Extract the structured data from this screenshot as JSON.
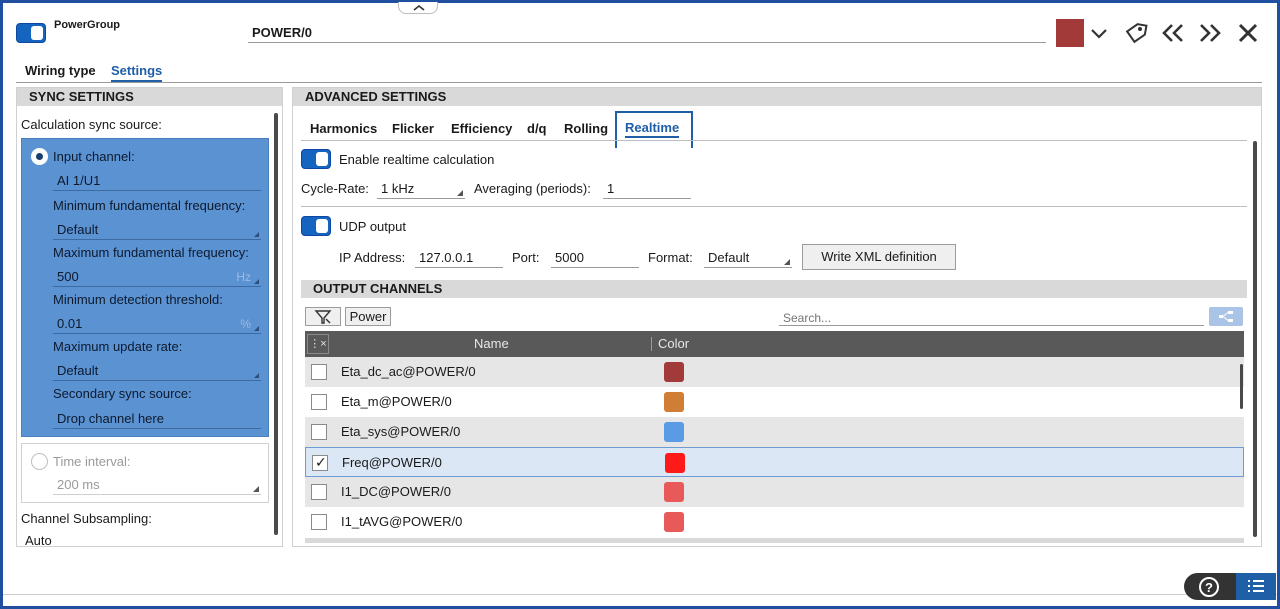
{
  "header": {
    "group_label": "PowerGroup",
    "name_value": "POWER/0",
    "color_swatch": "#a33a3a",
    "icons": [
      "chevron-down-icon",
      "tag-icon",
      "double-chevron-left-icon",
      "double-chevron-right-icon",
      "close-icon"
    ]
  },
  "top_tabs": [
    {
      "label": "Wiring type",
      "active": false
    },
    {
      "label": "Settings",
      "active": true
    }
  ],
  "sync": {
    "section_title": "SYNC SETTINGS",
    "calc_source_label": "Calculation sync source:",
    "input_channel_label": "Input channel:",
    "input_channel_value": "AI 1/U1",
    "min_freq_label": "Minimum fundamental frequency:",
    "min_freq_value": "Default",
    "max_freq_label": "Maximum fundamental frequency:",
    "max_freq_value": "500",
    "max_freq_unit": "Hz",
    "min_thresh_label": "Minimum detection threshold:",
    "min_thresh_value": "0.01",
    "min_thresh_unit": "%",
    "max_rate_label": "Maximum update rate:",
    "max_rate_value": "Default",
    "secondary_label": "Secondary sync source:",
    "secondary_value": "Drop channel here",
    "time_interval_label": "Time interval:",
    "time_interval_value": "200 ms",
    "subsampling_label": "Channel Subsampling:",
    "subsampling_value": "Auto"
  },
  "advanced": {
    "section_title": "ADVANCED SETTINGS",
    "tabs": [
      "Harmonics",
      "Flicker",
      "Efficiency",
      "d/q",
      "Rolling",
      "Realtime"
    ],
    "active_tab": "Realtime",
    "enable_label": "Enable realtime calculation",
    "cycle_rate_label": "Cycle-Rate:",
    "cycle_rate_value": "1 kHz",
    "averaging_label": "Averaging (periods):",
    "averaging_value": "1",
    "udp_label": "UDP output",
    "ip_label": "IP Address:",
    "ip_value": "127.0.0.1",
    "port_label": "Port:",
    "port_value": "5000",
    "format_label": "Format:",
    "format_value": "Default",
    "write_xml_label": "Write XML definition"
  },
  "output": {
    "section_title": "OUTPUT CHANNELS",
    "filter_chip": "Power",
    "search_placeholder": "Search...",
    "col_name": "Name",
    "col_color": "Color",
    "rows": [
      {
        "name": "Eta_dc_ac@POWER/0",
        "color": "#a33a3a",
        "checked": false
      },
      {
        "name": "Eta_m@POWER/0",
        "color": "#d07d35",
        "checked": false
      },
      {
        "name": "Eta_sys@POWER/0",
        "color": "#5a9be6",
        "checked": false
      },
      {
        "name": "Freq@POWER/0",
        "color": "#ff1a1a",
        "checked": true
      },
      {
        "name": "I1_DC@POWER/0",
        "color": "#e85a5a",
        "checked": false
      },
      {
        "name": "I1_tAVG@POWER/0",
        "color": "#e85a5a",
        "checked": false
      }
    ]
  },
  "footer": {
    "icons": [
      "help-icon",
      "list-icon"
    ]
  }
}
